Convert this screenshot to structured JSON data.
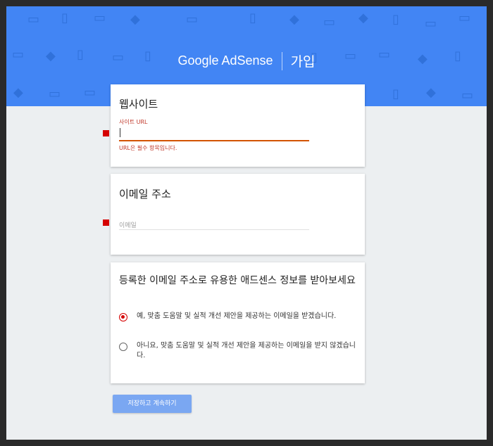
{
  "header": {
    "brand": "Google AdSense",
    "page_title": "가입"
  },
  "website_card": {
    "title": "웹사이트",
    "field_label": "사이트 URL",
    "field_value": "",
    "error": "URL은 필수 항목입니다."
  },
  "email_card": {
    "title": "이메일 주소",
    "placeholder": "이메일"
  },
  "newsletter_card": {
    "title": "등록한 이메일 주소로 유용한 애드센스 정보를 받아보세요",
    "options": [
      {
        "label": "예, 맞춤 도움말 및 실적 개선 제안을 제공하는 이메일을 받겠습니다.",
        "selected": true
      },
      {
        "label": "아니요, 맞춤 도움말 및 실적 개선 제안을 제공하는 이메일을 받지 않겠습니다.",
        "selected": false
      }
    ]
  },
  "actions": {
    "save_label": "저장하고 계속하기"
  },
  "colors": {
    "banner": "#4285f4",
    "accent": "#d50000",
    "button": "#7aa7f2",
    "error": "#c0392b"
  },
  "icons": {
    "pattern": "money-icon",
    "radio": "radio-icon"
  }
}
